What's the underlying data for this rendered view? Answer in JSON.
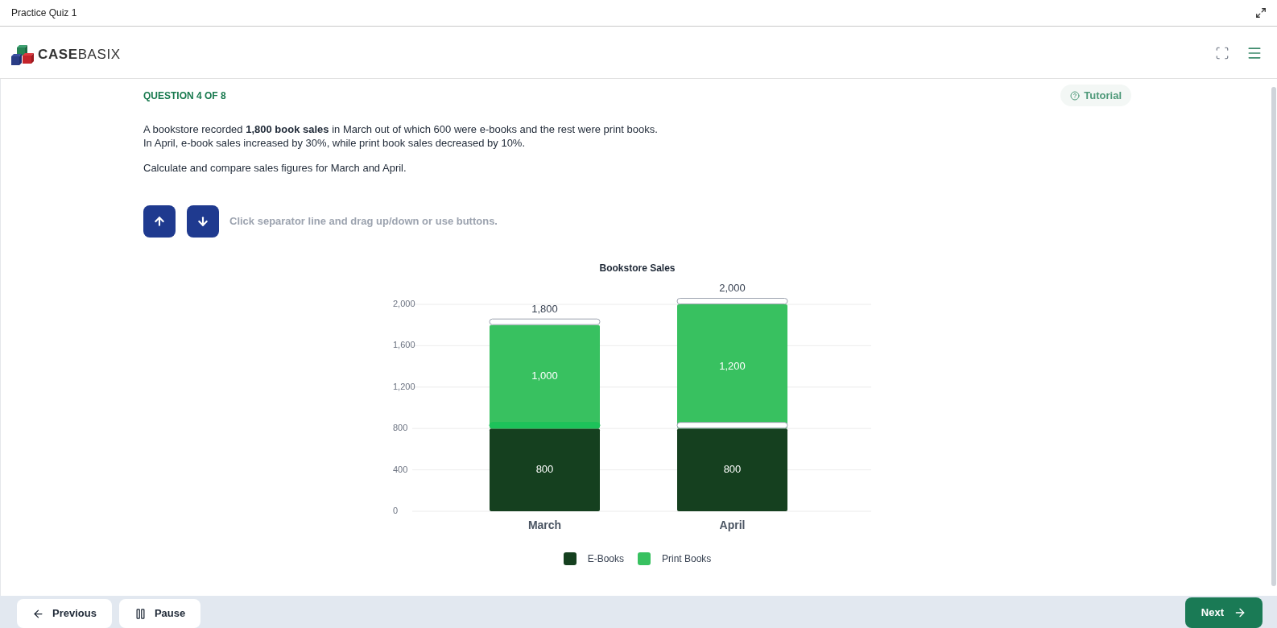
{
  "window": {
    "title": "Practice Quiz 1"
  },
  "header": {
    "logo": "**CASE**BASIX"
  },
  "question": {
    "label": "QUESTION 4 OF 8",
    "tutorial": "Tutorial",
    "lines": [
      "A bookstore recorded **1,800 book sales** in March out of which 600 were e-books and the rest were print books.",
      "In April, e-book sales increased by 30%, while print book sales decreased by 10%."
    ],
    "instruction": "Calculate and compare sales figures for March and April."
  },
  "controls": {
    "hint": "Click separator line and drag up/down or use buttons."
  },
  "chart": {
    "chart_data": {
      "type": "bar",
      "title": "Bookstore Sales",
      "categories": [
        "March",
        "April"
      ],
      "series": [
        {
          "name": "E-Books",
          "color": "#15401f",
          "values": [
            800,
            800
          ]
        },
        {
          "name": "Print Books",
          "color": "#38c160",
          "values": [
            1000,
            1200
          ]
        }
      ],
      "ylim": [
        0,
        2000
      ],
      "yticks": [
        {
          "value": 0,
          "label": "0"
        },
        {
          "value": 400,
          "label": "400"
        },
        {
          "value": 800,
          "label": "800"
        },
        {
          "value": 1200,
          "label": "1,200"
        },
        {
          "value": 1600,
          "label": "1,600"
        },
        {
          "value": 2000,
          "label": "2,000"
        }
      ],
      "stacked": true,
      "grid": true,
      "legend": true,
      "value_labels": [
        [
          "800",
          "800"
        ],
        [
          "1,000",
          "1,200"
        ]
      ],
      "annotations": [
        "1,800",
        "2,000"
      ]
    },
    "separators": [
      {
        "middle": {
          "selected": true
        },
        "top": {
          "selected": false
        }
      },
      {
        "middle": {
          "selected": false
        },
        "top": {
          "selected": false
        }
      }
    ]
  },
  "footer": {
    "buttons": [
      {
        "label": "Previous",
        "kind": "back"
      },
      {
        "label": "Pause",
        "kind": "pause"
      }
    ],
    "next": "Next"
  }
}
